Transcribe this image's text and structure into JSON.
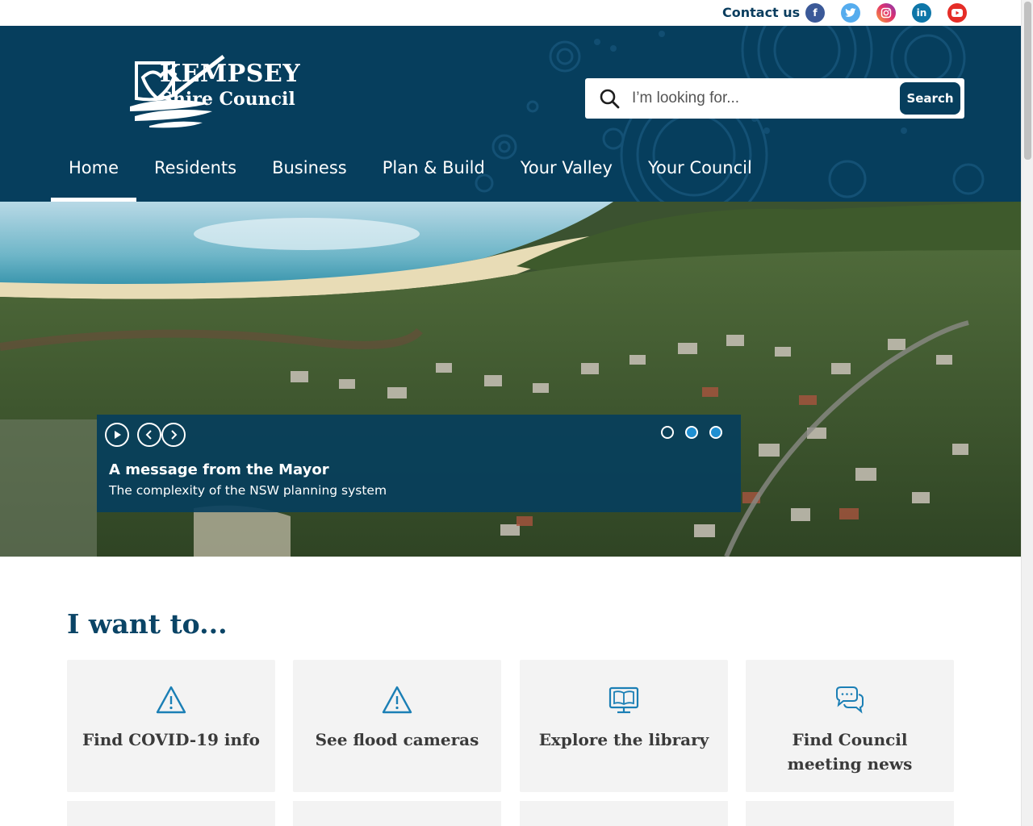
{
  "topbar": {
    "contact_label": "Contact us",
    "social": [
      {
        "name": "facebook-icon",
        "glyph": "f"
      },
      {
        "name": "twitter-icon",
        "glyph": "t"
      },
      {
        "name": "instagram-icon",
        "glyph": "◎"
      },
      {
        "name": "linkedin-icon",
        "glyph": "in"
      },
      {
        "name": "youtube-icon",
        "glyph": "▶"
      }
    ]
  },
  "header": {
    "logo_line1": "KEMPSEY",
    "logo_line2": "Shire Council",
    "search": {
      "placeholder": "I’m looking for...",
      "button_label": "Search"
    },
    "nav": [
      "Home",
      "Residents",
      "Business",
      "Plan & Build",
      "Your Valley",
      "Your Council"
    ],
    "active_nav": "Home"
  },
  "hero": {
    "title": "A message from the Mayor",
    "subtitle": "The complexity of the NSW planning system",
    "slides_total": 3,
    "active_slide": 1
  },
  "want": {
    "title": "I want to...",
    "tiles": [
      {
        "label": "Find COVID-19 info",
        "icon": "warning-icon"
      },
      {
        "label": "See flood cameras",
        "icon": "warning-icon"
      },
      {
        "label": "Explore the library",
        "icon": "library-icon"
      },
      {
        "label": "Find Council meeting news",
        "icon": "chat-bubbles-icon"
      }
    ]
  },
  "colors": {
    "brand_navy": "#063e5d",
    "heading_blue": "#0a4466",
    "icon_blue": "#1b7fb5",
    "dot_active": "#1f8fd1"
  }
}
